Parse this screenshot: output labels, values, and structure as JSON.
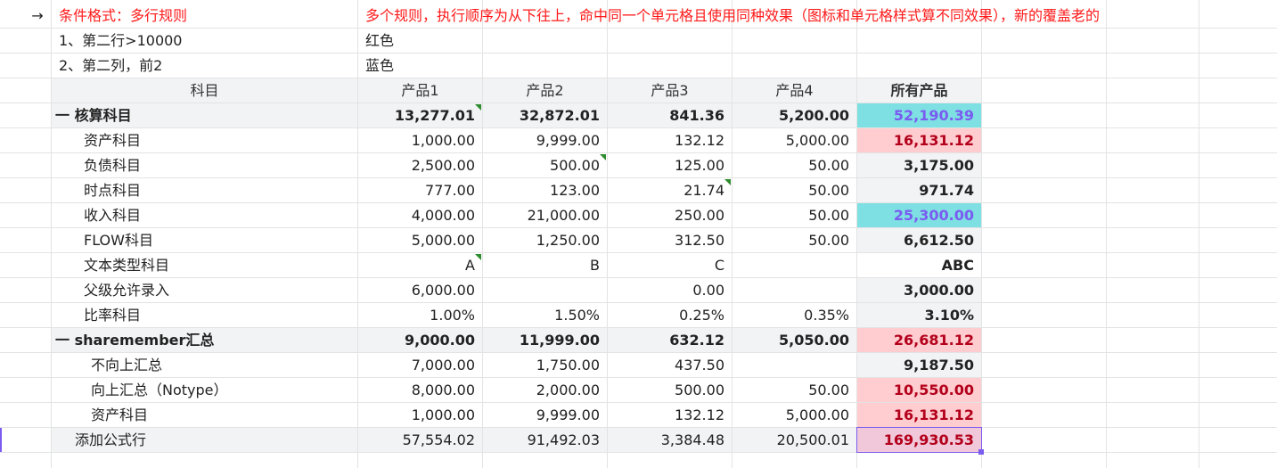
{
  "note": {
    "arrow": "→",
    "title": "条件格式：多行规则",
    "description": "多个规则，执行顺序为从下往上，命中同一个单元格且使用同种效果（图标和单元格样式算不同效果），新的覆盖老的",
    "rule1": "1、第二行>10000",
    "rule1_effect": "红色",
    "rule2": "2、第二列，前2",
    "rule2_effect": "蓝色"
  },
  "table": {
    "header": {
      "subject": "科目",
      "p1": "产品1",
      "p2": "产品2",
      "p3": "产品3",
      "p4": "产品4",
      "all": "所有产品"
    },
    "rows": [
      {
        "label": "一 核算科目",
        "p1": "13,277.01",
        "p2": "32,872.01",
        "p3": "841.36",
        "p4": "5,200.00",
        "all": "52,190.39"
      },
      {
        "label": "资产科目",
        "p1": "1,000.00",
        "p2": "9,999.00",
        "p3": "132.12",
        "p4": "5,000.00",
        "all": "16,131.12"
      },
      {
        "label": "负债科目",
        "p1": "2,500.00",
        "p2": "500.00",
        "p3": "125.00",
        "p4": "50.00",
        "all": "3,175.00"
      },
      {
        "label": "时点科目",
        "p1": "777.00",
        "p2": "123.00",
        "p3": "21.74",
        "p4": "50.00",
        "all": "971.74"
      },
      {
        "label": "收入科目",
        "p1": "4,000.00",
        "p2": "21,000.00",
        "p3": "250.00",
        "p4": "50.00",
        "all": "25,300.00"
      },
      {
        "label": "FLOW科目",
        "p1": "5,000.00",
        "p2": "1,250.00",
        "p3": "312.50",
        "p4": "50.00",
        "all": "6,612.50"
      },
      {
        "label": "文本类型科目",
        "p1": "A",
        "p2": "B",
        "p3": "C",
        "p4": "",
        "all": "ABC"
      },
      {
        "label": "父级允许录入",
        "p1": "6,000.00",
        "p2": "",
        "p3": "0.00",
        "p4": "",
        "all": "3,000.00"
      },
      {
        "label": "比率科目",
        "p1": "1.00%",
        "p2": "1.50%",
        "p3": "0.25%",
        "p4": "0.35%",
        "all": "3.10%"
      },
      {
        "label": "一  sharemember汇总",
        "p1": "9,000.00",
        "p2": "11,999.00",
        "p3": "632.12",
        "p4": "5,050.00",
        "all": "26,681.12"
      },
      {
        "label": "不向上汇总",
        "p1": "7,000.00",
        "p2": "1,750.00",
        "p3": "437.50",
        "p4": "",
        "all": "9,187.50"
      },
      {
        "label": "向上汇总（Notype）",
        "p1": "8,000.00",
        "p2": "2,000.00",
        "p3": "500.00",
        "p4": "50.00",
        "all": "10,550.00"
      },
      {
        "label": "资产科目",
        "p1": "1,000.00",
        "p2": "9,999.00",
        "p3": "132.12",
        "p4": "5,000.00",
        "all": "16,131.12"
      },
      {
        "label": "添加公式行",
        "p1": "57,554.02",
        "p2": "91,492.03",
        "p3": "3,384.48",
        "p4": "20,500.01",
        "all": "169,930.53"
      }
    ]
  },
  "colors": {
    "note_red": "#ff1a1a",
    "highlight_cyan": "#7ee0e3",
    "highlight_cyan_text": "#7a5cf0",
    "highlight_pink": "#ffcccf",
    "highlight_pink_text": "#b3001b",
    "selection": "#7b5cf0",
    "comment_marker": "#2e8b2e"
  }
}
